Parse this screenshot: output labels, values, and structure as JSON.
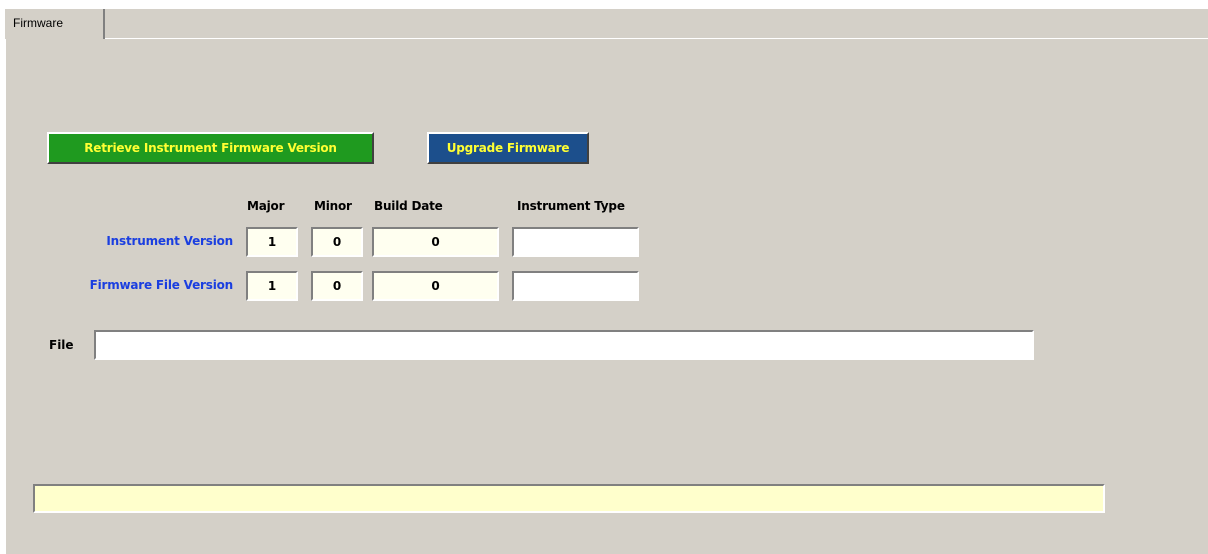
{
  "tabs": [
    {
      "label": "Firmware",
      "active": true
    }
  ],
  "buttons": {
    "retrieve_label": "Retrieve Instrument Firmware Version",
    "upgrade_label": "Upgrade Firmware"
  },
  "table": {
    "headers": {
      "major": "Major",
      "minor": "Minor",
      "build_date": "Build Date",
      "instrument_type": "Instrument Type"
    },
    "rows": [
      {
        "label": "Instrument Version",
        "major": "1",
        "minor": "0",
        "build_date": "0",
        "instrument_type": ""
      },
      {
        "label": "Firmware File Version",
        "major": "1",
        "minor": "0",
        "build_date": "0",
        "instrument_type": ""
      }
    ]
  },
  "file": {
    "label": "File",
    "value": ""
  },
  "status": {
    "text": ""
  },
  "colors": {
    "panel_bg": "#d4d0c8",
    "retrieve_button_bg": "#1f9a1f",
    "upgrade_button_bg": "#1c4f8c",
    "button_text": "#ffff33",
    "row_label_text": "#1a3ee0",
    "field_bg": "#fffff0",
    "status_bg": "#ffffcc"
  }
}
